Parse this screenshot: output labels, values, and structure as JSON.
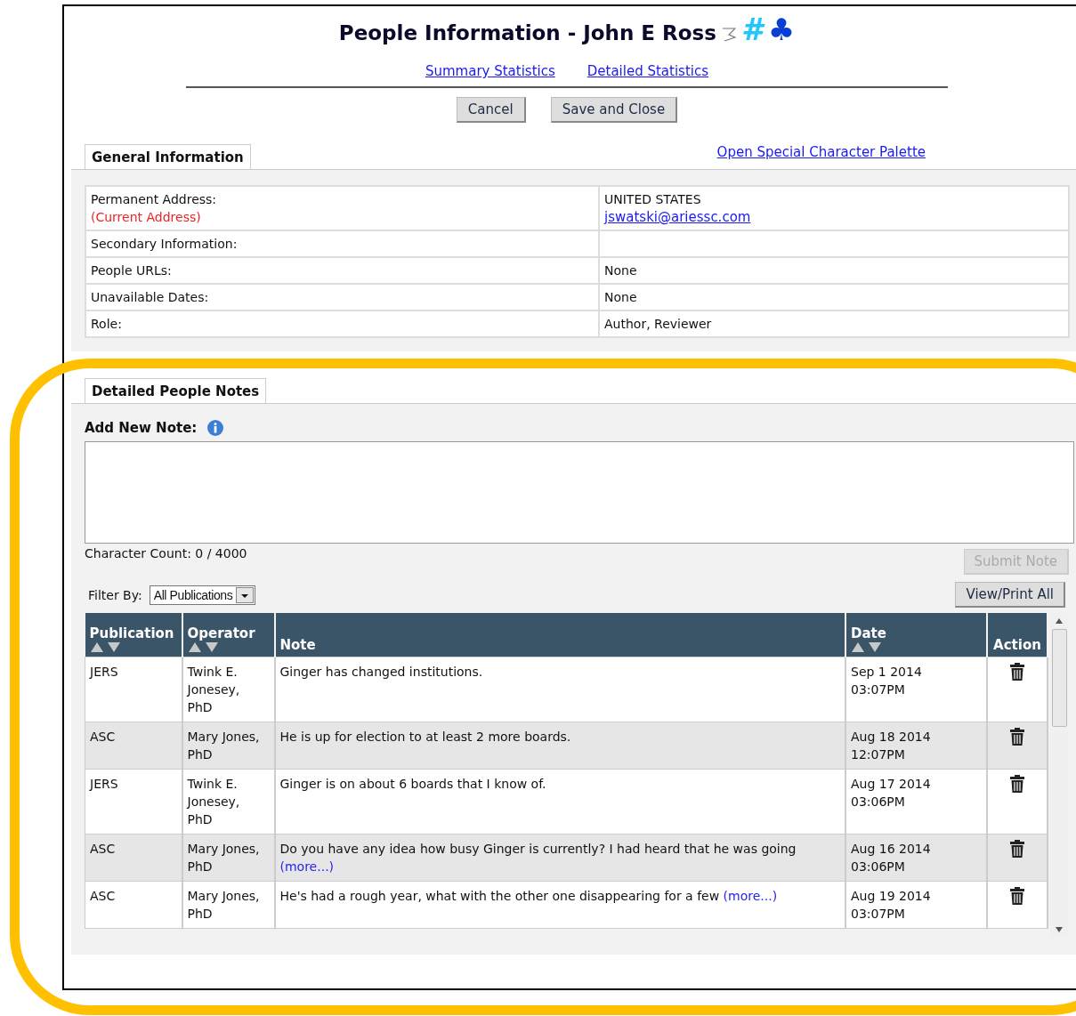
{
  "title": "People Information - John E Ross",
  "hash_mark": "#",
  "club_mark": "♣",
  "links": [
    "Summary Statistics",
    "Detailed Statistics"
  ],
  "buttons": [
    "Cancel",
    "Save and Close"
  ],
  "general": {
    "tab": "General Information",
    "palette_link": "Open Special Character Palette",
    "rows": [
      {
        "label": "Permanent Address:",
        "sublabel": "(Current Address)",
        "value": "UNITED STATES",
        "email": "jswatski@ariessc.com"
      },
      {
        "label": "Secondary Information:",
        "value": ""
      },
      {
        "label": "People URLs:",
        "value": "None"
      },
      {
        "label": "Unavailable Dates:",
        "value": "None"
      },
      {
        "label": "Role:",
        "value": "Author, Reviewer"
      }
    ]
  },
  "notes": {
    "tab": "Detailed People Notes",
    "add_label": "Add New Note:",
    "char_count": "Character Count: 0 / 4000",
    "submit": {
      "label": "Submit Note",
      "disabled": true
    },
    "filter": {
      "label": "Filter By:",
      "value": "All Publications"
    },
    "view_print": "View/Print All",
    "columns": [
      {
        "label": "Publication",
        "sortable": true
      },
      {
        "label": "Operator",
        "sortable": true
      },
      {
        "label": "Note",
        "sortable": false
      },
      {
        "label": "Date",
        "sortable": true
      },
      {
        "label": "Action",
        "sortable": false
      }
    ],
    "rows": [
      {
        "publication": "JERS",
        "operator": "Twink E. Jonesey, PhD",
        "note": "Ginger has changed institutions.",
        "date": "Sep 1 2014",
        "time": "03:07PM"
      },
      {
        "publication": "ASC",
        "operator": "Mary Jones, PhD",
        "note": "He is up for election to at least 2 more boards.",
        "date": "Aug 18 2014",
        "time": "12:07PM"
      },
      {
        "publication": "JERS",
        "operator": "Twink E. Jonesey, PhD",
        "note": "Ginger is on about 6 boards that I know of.",
        "date": "Aug 17 2014",
        "time": "03:06PM"
      },
      {
        "publication": "ASC",
        "operator": "Mary Jones, PhD",
        "note": "Do you have any idea how busy Ginger is currently? I had heard that he was going",
        "more": "(more...)",
        "date": "Aug 16 2014",
        "time": "03:06PM"
      },
      {
        "publication": "ASC",
        "operator": "Mary Jones, PhD",
        "note": "He's had a rough year, what with the other one disappearing for a few",
        "more": "(more...)",
        "date": "Aug 19 2014",
        "time": "03:07PM"
      }
    ]
  }
}
